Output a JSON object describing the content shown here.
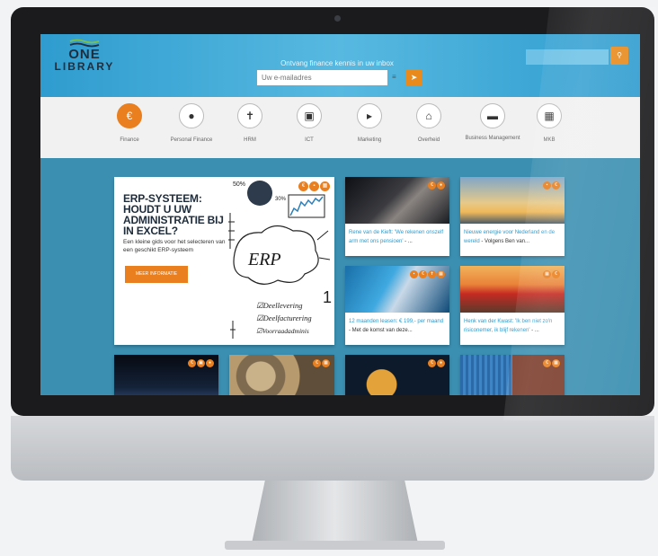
{
  "header": {
    "logo_line1": "ONE",
    "logo_line2": "LIBRARY",
    "tagline": "Ontvang finance kennis in uw inbox",
    "email_placeholder": "Uw e-mailadres"
  },
  "categories": [
    {
      "label": "Finance",
      "icon": "euro-icon",
      "glyph": "€",
      "active": true
    },
    {
      "label": "Personal Finance",
      "icon": "money-bag-icon",
      "glyph": "💰",
      "active": false
    },
    {
      "label": "HRM",
      "icon": "person-icon",
      "glyph": "🚶",
      "active": false
    },
    {
      "label": "ICT",
      "icon": "laptop-icon",
      "glyph": "💻",
      "active": false
    },
    {
      "label": "Marketing",
      "icon": "megaphone-icon",
      "glyph": "📢",
      "active": false
    },
    {
      "label": "Overheid",
      "icon": "government-building-icon",
      "glyph": "🏛",
      "active": false
    },
    {
      "label": "Business Management",
      "icon": "briefcase-icon",
      "glyph": "💼",
      "active": false
    },
    {
      "label": "MKB",
      "icon": "shop-icon",
      "glyph": "🏪",
      "active": false
    }
  ],
  "featured": {
    "title": "ERP-SYSTEEM: HOUDT U UW ADMINISTRATIE BIJ IN EXCEL?",
    "description": "Een kleine gids voor het selecteren van een geschikt ERP-systeem",
    "button": "MEER INFORMATIE",
    "sketch_text": {
      "erp": "ERP",
      "line1": "☑Deellevering",
      "line2": "☑Deelfacturering",
      "line3": "☑Voorraadadminis",
      "pct1": "50%",
      "pct2": "30%"
    }
  },
  "articles": [
    {
      "caption": "Rene van de Kieft: 'We rekenen onszelf arm met ons pensioen'",
      "tail": " - ..."
    },
    {
      "caption": "Nieuwe energie voor Nederland en de wereld",
      "tail": " - Volgens Ben van..."
    },
    {
      "caption": "12 maanden leasen: € 199,- per maand",
      "tail": " - Met de komst van deze..."
    },
    {
      "caption": "Henk van der Kwast: 'Ik ben niet zo'n risiconemer, ik blijf rekenen'",
      "tail": " - ..."
    }
  ],
  "colors": {
    "accent": "#e97f1e",
    "header_blue": "#2f9ccf",
    "content_blue": "#3b8fb1"
  }
}
